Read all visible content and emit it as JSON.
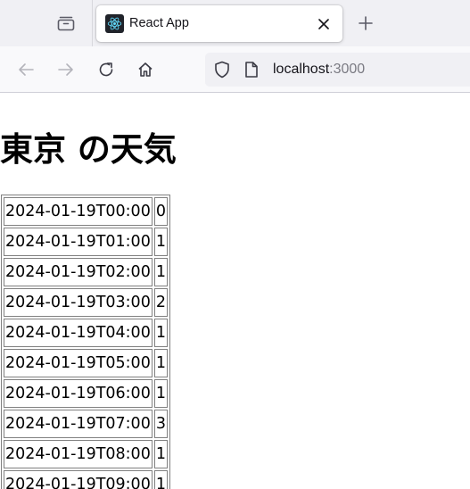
{
  "browser": {
    "tab_title": "React App",
    "url_host": "localhost",
    "url_port": ":3000"
  },
  "page": {
    "title": "東京 の天気",
    "rows": [
      {
        "time": "2024-01-19T00:00",
        "value": "0"
      },
      {
        "time": "2024-01-19T01:00",
        "value": "1"
      },
      {
        "time": "2024-01-19T02:00",
        "value": "1"
      },
      {
        "time": "2024-01-19T03:00",
        "value": "2"
      },
      {
        "time": "2024-01-19T04:00",
        "value": "1"
      },
      {
        "time": "2024-01-19T05:00",
        "value": "1"
      },
      {
        "time": "2024-01-19T06:00",
        "value": "1"
      },
      {
        "time": "2024-01-19T07:00",
        "value": "3"
      },
      {
        "time": "2024-01-19T08:00",
        "value": "1"
      },
      {
        "time": "2024-01-19T09:00",
        "value": "1"
      }
    ]
  },
  "icons": {
    "tab_list": "tab-list-icon",
    "favicon": "react-logo-icon",
    "close": "close-icon",
    "new_tab": "plus-icon",
    "back": "arrow-left-icon",
    "forward": "arrow-right-icon",
    "reload": "reload-icon",
    "home": "home-icon",
    "tracking": "shield-icon",
    "page_info": "page-icon"
  },
  "colors": {
    "tab_strip": "#f0f0f4",
    "toolbar": "#f9f9fb",
    "react_logo": "#61dafb"
  }
}
